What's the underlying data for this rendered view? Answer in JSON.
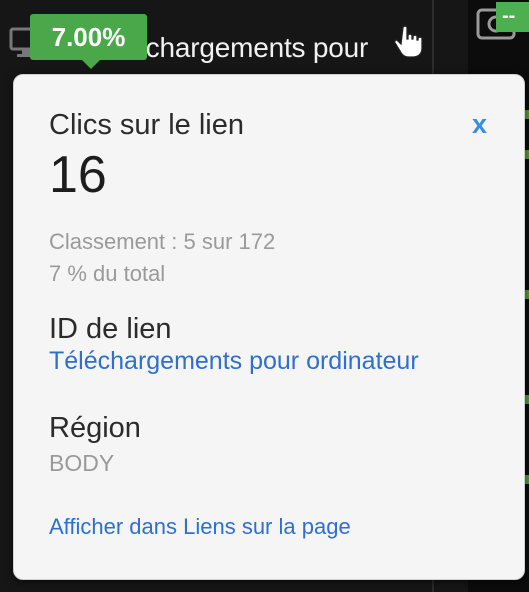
{
  "background": {
    "link_text": "Téléchargements pour",
    "right_badge": "--"
  },
  "badge": {
    "percent": "7.00%",
    "color": "#4aa84a"
  },
  "popover": {
    "title": "Clics sur le lien",
    "close_label": "x",
    "value": "16",
    "rank": "Classement : 5 sur 172",
    "share": "7 % du total",
    "id_label": "ID de lien",
    "id_value": "Téléchargements pour ordinateur",
    "region_label": "Région",
    "region_value": "BODY",
    "footer_link": "Afficher dans Liens sur la page"
  },
  "colors": {
    "link": "#2f6fcf",
    "close": "#3b8de0",
    "muted": "#9a9a9a"
  },
  "icons": [
    "monitor-icon",
    "pointer-hand-icon",
    "camera-icon"
  ]
}
